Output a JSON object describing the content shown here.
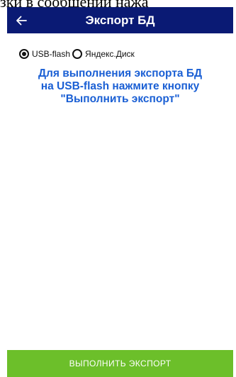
{
  "background_text": "зки в сообщении нажа",
  "appbar": {
    "back_icon": "arrow-left-icon",
    "title": "Экспорт БД",
    "background_color": "#0a1a74"
  },
  "export_target": {
    "options": [
      {
        "label": "USB-flash",
        "selected": true
      },
      {
        "label": "Яндекс.Диск",
        "selected": false
      }
    ]
  },
  "info": {
    "lines": [
      "Для выполнения экспорта БД",
      "на USB-flash нажмите кнопку",
      "\"Выполнить экспорт\""
    ],
    "color": "#1a5fd4"
  },
  "actions": {
    "export_label": "ВЫПОЛНИТЬ ЭКСПОРТ",
    "export_color": "#6cbf2a"
  }
}
